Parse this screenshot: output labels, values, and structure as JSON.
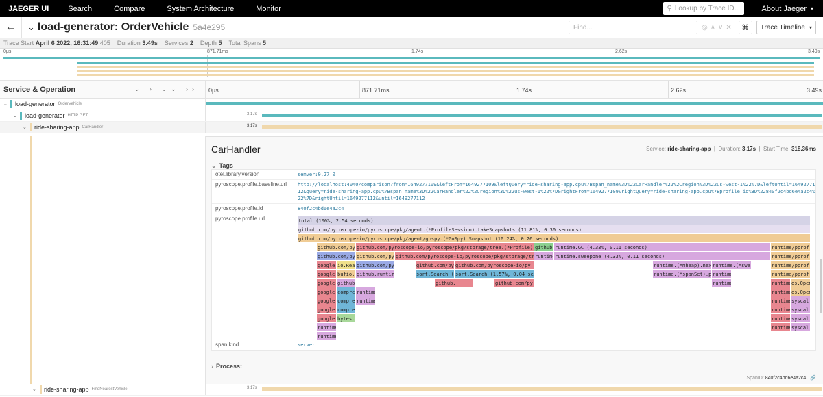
{
  "nav": {
    "brand": "JAEGER UI",
    "links": [
      "Search",
      "Compare",
      "System Architecture",
      "Monitor"
    ],
    "lookup_placeholder": "Lookup by Trace ID...",
    "about": "About Jaeger"
  },
  "trace": {
    "name": "load-generator: OrderVehicle",
    "id": "5a4e295",
    "find_placeholder": "Find...",
    "view": "Trace Timeline"
  },
  "summary": {
    "start_label": "Trace Start",
    "start": "April 6 2022, 16:31:49",
    "start_ms": ".405",
    "duration_label": "Duration",
    "duration": "3.49s",
    "services_label": "Services",
    "services": "2",
    "depth_label": "Depth",
    "depth": "5",
    "spans_label": "Total Spans",
    "spans": "5"
  },
  "ticks": [
    "0μs",
    "871.71ms",
    "1.74s",
    "2.62s",
    "3.49s"
  ],
  "header": {
    "label": "Service & Operation"
  },
  "colors": {
    "load_generator": "#5ab9bd",
    "ride_sharing": "#f0d8ac"
  },
  "spans": [
    {
      "service": "load-generator",
      "op": "OrderVehicle",
      "duration": ""
    },
    {
      "service": "load-generator",
      "op": "HTTP GET",
      "duration": "3.17s"
    },
    {
      "service": "ride-sharing-app",
      "op": "CarHandler",
      "duration": "3.17s"
    },
    {
      "service": "ride-sharing-app",
      "op": "FindNearestVehicle",
      "duration": "3.17s"
    }
  ],
  "detail": {
    "title": "CarHandler",
    "service_label": "Service:",
    "service": "ride-sharing-app",
    "duration_label": "Duration:",
    "duration": "3.17s",
    "start_label": "Start Time:",
    "start": "318.36ms",
    "tags_label": "Tags",
    "process_label": "Process:",
    "spanid_label": "SpanID:",
    "spanid": "840f2c4bd6e4a2c4",
    "tags": [
      {
        "key": "otel.library.version",
        "value": "semver:0.27.0"
      },
      {
        "key": "pyroscope.profile.baseline.url",
        "value": "http://localhost:4040/comparison?from=1649277109&leftFrom=1649277109&leftQuery=ride-sharing-app.cpu%7Bspan_name%3D%22CarHandler%22%2Cregion%3D%22us-west-1%22%7D&leftUntil=1649277112&query=ride-sharing-app.cpu%7Bspan_name%3D%22CarHandler%22%2Cregion%3D%22us-west-1%22%7D&rightFrom=1649277109&rightQuery=ride-sharing-app.cpu%7Bprofile_id%3D%22840f2c4bd6e4a2c4%22%7D&rightUntil=1649277112&until=1649277112"
      },
      {
        "key": "pyroscope.profile.id",
        "value": "840f2c4bd6e4a2c4"
      },
      {
        "key": "pyroscope.profile.url",
        "value": ""
      },
      {
        "key": "span.kind",
        "value": "server"
      }
    ],
    "flame": [
      "total (100%, 2.54 seconds)",
      "github.com/pyroscope-io/pyroscope/pkg/agent.(*ProfileSession).takeSnapshots (11.81%, 0.30 seconds)",
      "github.com/pyroscope-io/pyroscope/pkg/agent/gospy.(*GoSpy).Snapshot (10.24%, 0.26 seconds)",
      "github.com/py",
      "github.com/pyroscope-io/pyroscope/pkg/storage/tree.(*Profile).",
      "github.",
      "runtime.GC (4.33%, 0.11 seconds)",
      "runtime/pprof",
      "github.com/py",
      "github.com/py",
      "github.com/pyroscope-io/pyroscope/pkg/storage/tr",
      "runtime",
      "runtime.sweepone (4.33%, 0.11 seconds)",
      "runtime/pprof",
      "google",
      "io.Read",
      "github.com/py",
      "github.com/py",
      "github.com/pyroscope-io/py",
      "runtime.(*mheap).nex",
      "runtime.(*swe",
      "runtime/pprof",
      "google",
      "bufio.",
      "github.runtime",
      "sort.Search (",
      "sort.Search (1.57%, 0.04 se",
      "runtime.(*spanSet).pop",
      "runtime",
      "runtime/pprof",
      "google",
      "github.",
      "github.",
      "github.com/py",
      "runtime",
      "runtime",
      "os.Open",
      "google",
      "compre",
      "runtime",
      "runtime",
      "os.Open",
      "google",
      "compre",
      "runtime",
      "runtime",
      "syscal",
      "google",
      "compre",
      "runtime",
      "syscal",
      "google",
      "bytes.",
      "runtime",
      "syscal",
      "runtime",
      "runtime",
      "syscal",
      "runtime",
      "runtime",
      "runtime"
    ]
  }
}
